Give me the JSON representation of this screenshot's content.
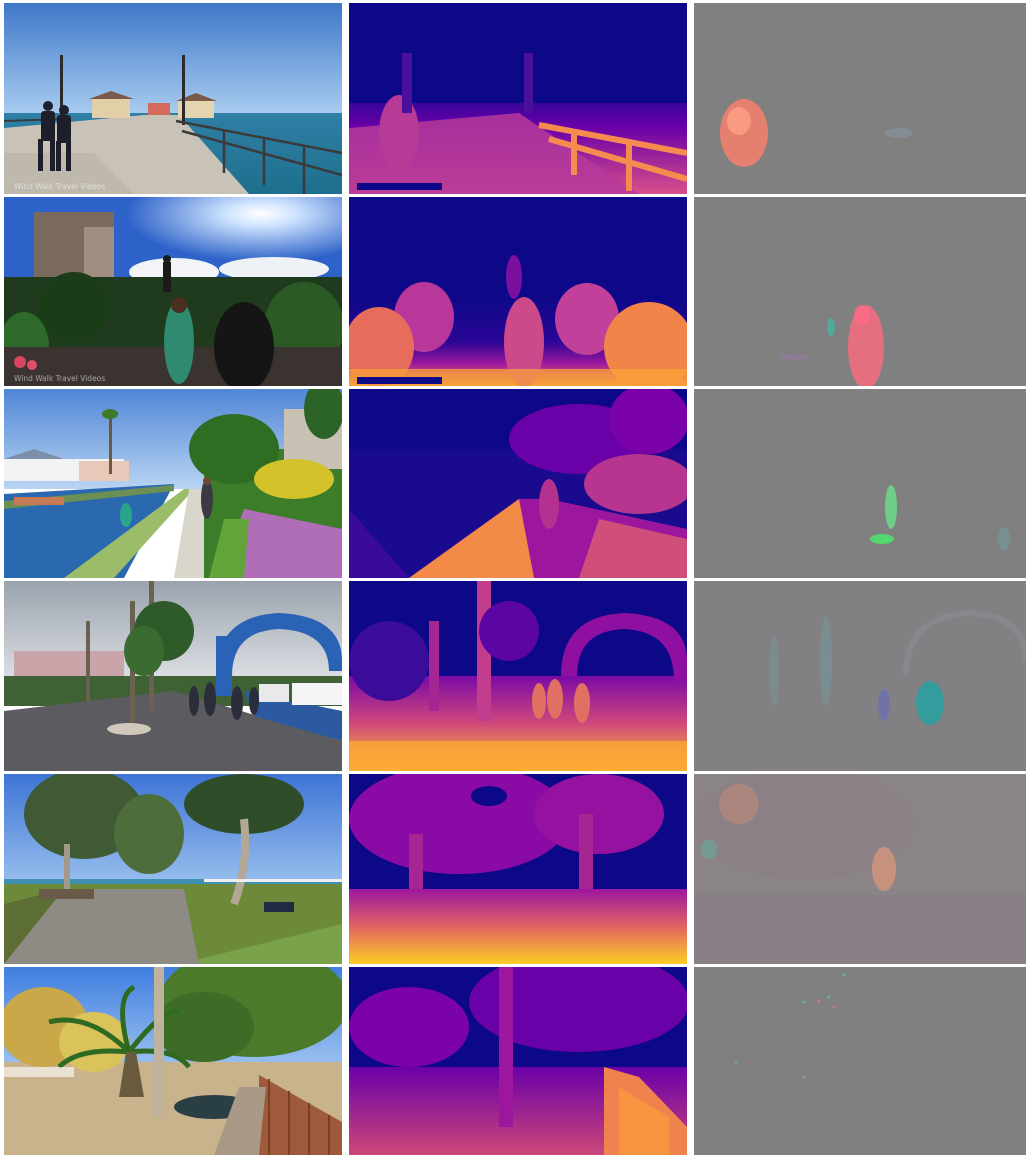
{
  "watermarks": {
    "row1": "Wind Walk Travel Videos",
    "row2": "Wind Walk Travel Videos"
  },
  "columns": [
    "rgb-frame",
    "depth-map",
    "motion-residual"
  ],
  "colors": {
    "depth_far": "#0d0887",
    "depth_mid": "#9c179e",
    "depth_near": "#fdb42f",
    "residual_bg": "#808080"
  }
}
